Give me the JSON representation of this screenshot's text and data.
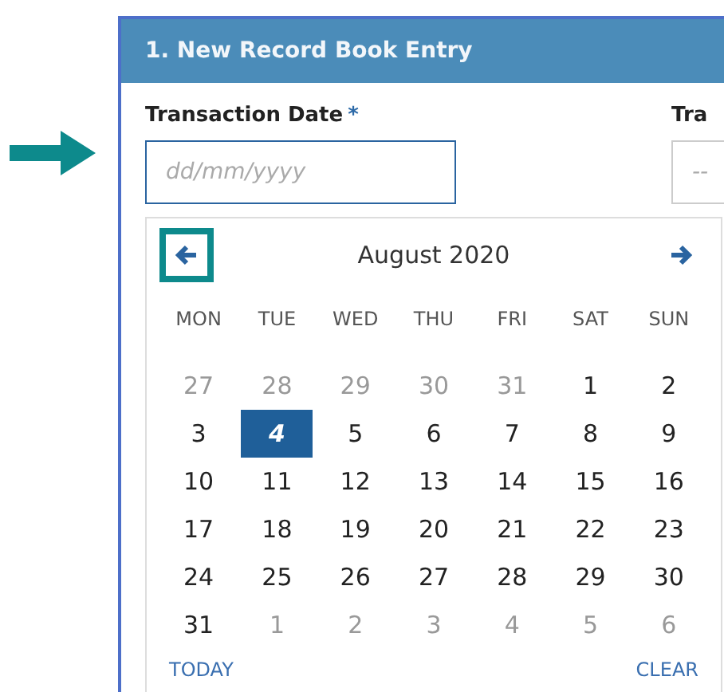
{
  "panel": {
    "title": "1. New Record Book Entry"
  },
  "fields": [
    {
      "label": "Transaction Date",
      "required_mark": "*",
      "placeholder": "dd/mm/yyyy",
      "focused": true
    },
    {
      "label": "Tra",
      "placeholder": "--",
      "focused": false
    }
  ],
  "datepicker": {
    "month": "August 2020",
    "prev_highlighted": true,
    "weekdays": [
      "MON",
      "TUE",
      "WED",
      "THU",
      "FRI",
      "SAT",
      "SUN"
    ],
    "weeks": [
      [
        {
          "label": "27",
          "muted": true,
          "selected": false
        },
        {
          "label": "28",
          "muted": true,
          "selected": false
        },
        {
          "label": "29",
          "muted": true,
          "selected": false
        },
        {
          "label": "30",
          "muted": true,
          "selected": false
        },
        {
          "label": "31",
          "muted": true,
          "selected": false
        },
        {
          "label": "1",
          "muted": false,
          "selected": false
        },
        {
          "label": "2",
          "muted": false,
          "selected": false
        }
      ],
      [
        {
          "label": "3",
          "muted": false,
          "selected": false
        },
        {
          "label": "4",
          "muted": false,
          "selected": true
        },
        {
          "label": "5",
          "muted": false,
          "selected": false
        },
        {
          "label": "6",
          "muted": false,
          "selected": false
        },
        {
          "label": "7",
          "muted": false,
          "selected": false
        },
        {
          "label": "8",
          "muted": false,
          "selected": false
        },
        {
          "label": "9",
          "muted": false,
          "selected": false
        }
      ],
      [
        {
          "label": "10",
          "muted": false,
          "selected": false
        },
        {
          "label": "11",
          "muted": false,
          "selected": false
        },
        {
          "label": "12",
          "muted": false,
          "selected": false
        },
        {
          "label": "13",
          "muted": false,
          "selected": false
        },
        {
          "label": "14",
          "muted": false,
          "selected": false
        },
        {
          "label": "15",
          "muted": false,
          "selected": false
        },
        {
          "label": "16",
          "muted": false,
          "selected": false
        }
      ],
      [
        {
          "label": "17",
          "muted": false,
          "selected": false
        },
        {
          "label": "18",
          "muted": false,
          "selected": false
        },
        {
          "label": "19",
          "muted": false,
          "selected": false
        },
        {
          "label": "20",
          "muted": false,
          "selected": false
        },
        {
          "label": "21",
          "muted": false,
          "selected": false
        },
        {
          "label": "22",
          "muted": false,
          "selected": false
        },
        {
          "label": "23",
          "muted": false,
          "selected": false
        }
      ],
      [
        {
          "label": "24",
          "muted": false,
          "selected": false
        },
        {
          "label": "25",
          "muted": false,
          "selected": false
        },
        {
          "label": "26",
          "muted": false,
          "selected": false
        },
        {
          "label": "27",
          "muted": false,
          "selected": false
        },
        {
          "label": "28",
          "muted": false,
          "selected": false
        },
        {
          "label": "29",
          "muted": false,
          "selected": false
        },
        {
          "label": "30",
          "muted": false,
          "selected": false
        }
      ],
      [
        {
          "label": "31",
          "muted": false,
          "selected": false
        },
        {
          "label": "1",
          "muted": true,
          "selected": false
        },
        {
          "label": "2",
          "muted": true,
          "selected": false
        },
        {
          "label": "3",
          "muted": true,
          "selected": false
        },
        {
          "label": "4",
          "muted": true,
          "selected": false
        },
        {
          "label": "5",
          "muted": true,
          "selected": false
        },
        {
          "label": "6",
          "muted": true,
          "selected": false
        }
      ]
    ],
    "footer": [
      "TODAY",
      "CLEAR"
    ]
  }
}
